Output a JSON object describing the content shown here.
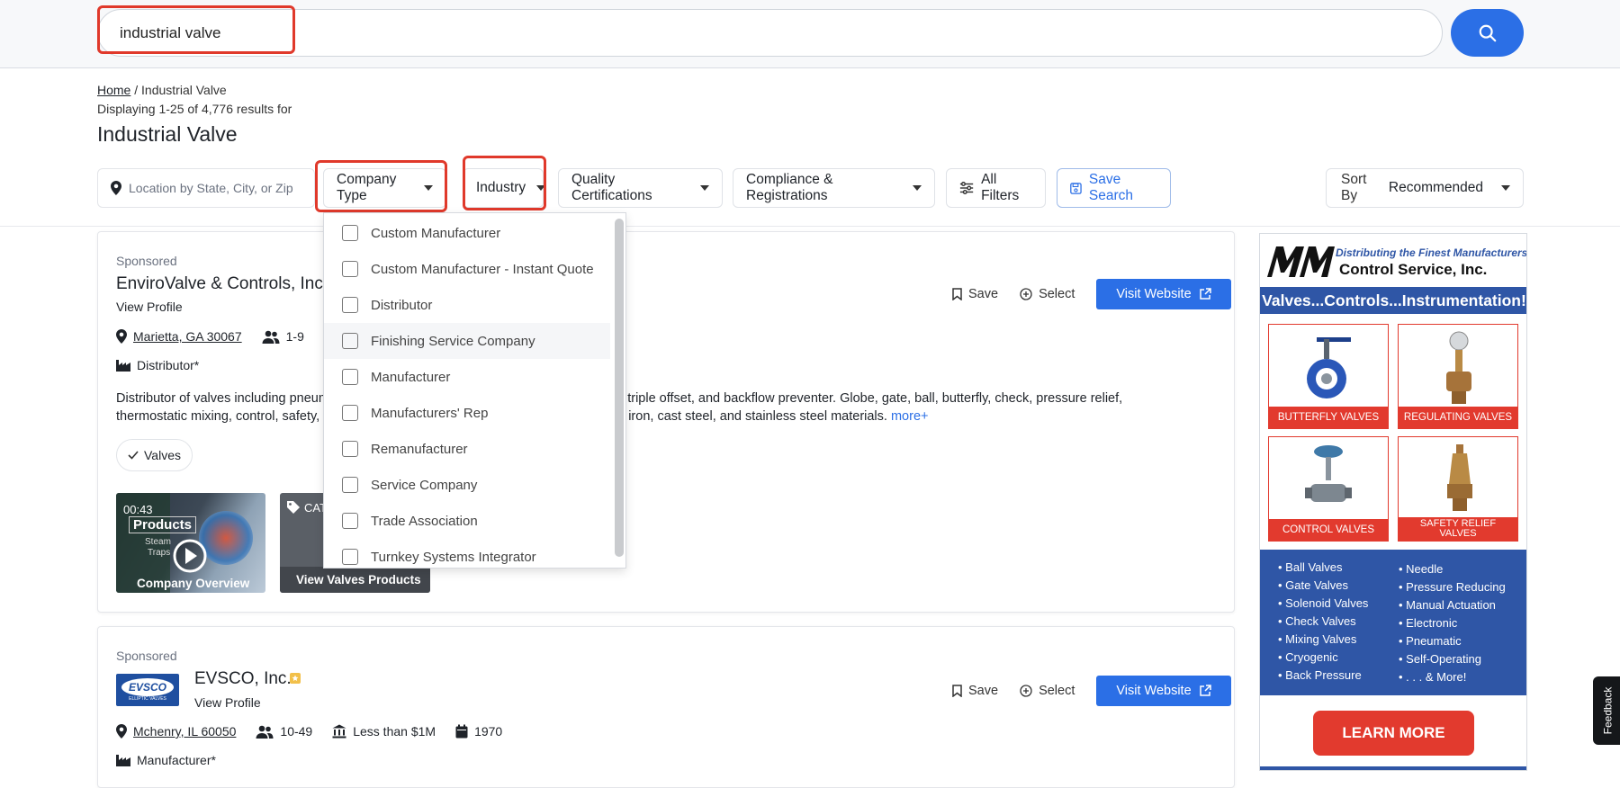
{
  "search": {
    "value": "industrial valve"
  },
  "breadcrumb": {
    "home": "Home",
    "separator": "/",
    "current": "Industrial Valve"
  },
  "results": {
    "count_text": "Displaying 1-25 of 4,776 results for",
    "title": "Industrial Valve"
  },
  "filters": {
    "location_placeholder": "Location by State, City, or Zip",
    "company_type": "Company Type",
    "industry": "Industry",
    "quality": "Quality Certifications",
    "compliance": "Compliance & Registrations",
    "all_filters": "All Filters",
    "save_search": "Save Search",
    "sort_label": "Sort By",
    "sort_value": "Recommended"
  },
  "company_type_options": [
    "Custom Manufacturer",
    "Custom Manufacturer - Instant Quote",
    "Distributor",
    "Finishing Service Company",
    "Manufacturer",
    "Manufacturers' Rep",
    "Remanufacturer",
    "Service Company",
    "Trade Association",
    "Turnkey Systems Integrator"
  ],
  "cards": [
    {
      "sponsored": "Sponsored",
      "name": "EnviroValve & Controls, Inc.",
      "view_profile": "View Profile",
      "location": "Marietta, GA 30067",
      "employees": "1-9",
      "type": "Distributor*",
      "desc_left_1": "Distributor of valves including pneuma",
      "desc_right_1": "ing, bellow seal, triple offset, and backflow preventer. Globe, gate, ball, butterfly, check, pressure relief,",
      "desc_left_2": "thermostatic mixing, control, safety, an",
      "desc_right_2": "ade from cast iron, cast steel, and stainless steel materials.",
      "more": "more+",
      "chip": "Valves",
      "video_time": "00:43",
      "video_products": "Products",
      "video_steam": "Steam",
      "video_traps": "Traps",
      "video_caption": "Company Overview",
      "catalog_tag": "CAT",
      "catalog_caption": "View Valves Products",
      "save": "Save",
      "select": "Select",
      "visit": "Visit Website"
    },
    {
      "sponsored": "Sponsored",
      "name": "EVSCO, Inc.",
      "view_profile": "View Profile",
      "logo_text": "EVSCO",
      "logo_sub": "ELLIPTIC VALVES",
      "location": "Mchenry, IL 60050",
      "employees": "10-49",
      "revenue": "Less than $1M",
      "year": "1970",
      "type": "Manufacturer*",
      "save": "Save",
      "select": "Select",
      "visit": "Visit Website"
    }
  ],
  "ad": {
    "tagline": "Distributing the Finest Manufacturers",
    "brand": "M&M",
    "company": "Control Service, Inc.",
    "banner": "Valves...Controls...Instrumentation!",
    "tiles": [
      "BUTTERFLY VALVES",
      "REGULATING VALVES",
      "CONTROL VALVES",
      "SAFETY RELIEF VALVES"
    ],
    "list_left": [
      "• Ball Valves",
      "• Gate Valves",
      "• Solenoid Valves",
      "• Check Valves",
      "• Mixing Valves",
      "• Cryogenic",
      "• Back Pressure"
    ],
    "list_right": [
      "• Needle",
      "• Pressure Reducing",
      "• Manual Actuation",
      "• Electronic",
      "• Pneumatic",
      "• Self-Operating",
      "• . . . & More!"
    ],
    "cta": "LEARN MORE"
  },
  "feedback": "Feedback",
  "colors": {
    "accent": "#2b6fe6",
    "highlight": "#e0392b",
    "ad_blue": "#2f56a6",
    "ad_red": "#e23a2e"
  }
}
